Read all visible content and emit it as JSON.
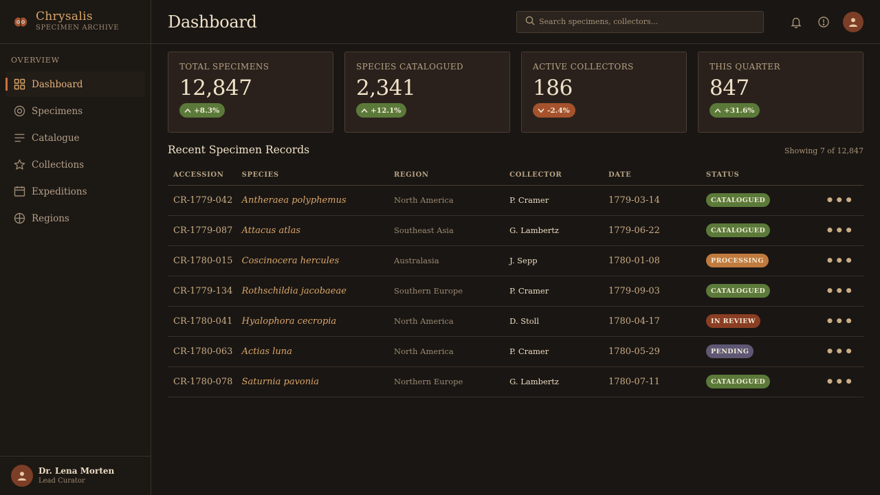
{
  "brand": {
    "title": "Chrysalis",
    "subtitle": "SPECIMEN ARCHIVE"
  },
  "sidebar": {
    "section_label": "OVERVIEW",
    "items": [
      {
        "label": "Dashboard",
        "icon": "grid-icon",
        "active": true
      },
      {
        "label": "Specimens",
        "icon": "target-icon",
        "active": false
      },
      {
        "label": "Catalogue",
        "icon": "list-icon",
        "active": false
      },
      {
        "label": "Collections",
        "icon": "star-icon",
        "active": false
      },
      {
        "label": "Expeditions",
        "icon": "calendar-icon",
        "active": false
      },
      {
        "label": "Regions",
        "icon": "globe-icon",
        "active": false
      }
    ],
    "user": {
      "name": "Dr. Lena Morten",
      "role": "Lead Curator"
    }
  },
  "header": {
    "title": "Dashboard",
    "search_placeholder": "Search specimens, collectors..."
  },
  "stats": [
    {
      "label": "TOTAL SPECIMENS",
      "value": "12,847",
      "delta": "+8.3%",
      "trend": "up"
    },
    {
      "label": "SPECIES CATALOGUED",
      "value": "2,341",
      "delta": "+12.1%",
      "trend": "up"
    },
    {
      "label": "ACTIVE COLLECTORS",
      "value": "186",
      "delta": "-2.4%",
      "trend": "down"
    },
    {
      "label": "THIS QUARTER",
      "value": "847",
      "delta": "+31.6%",
      "trend": "up"
    }
  ],
  "records": {
    "title": "Recent Specimen Records",
    "count_text": "Showing 7 of 12,847",
    "columns": [
      "ACCESSION",
      "SPECIES",
      "REGION",
      "COLLECTOR",
      "DATE",
      "STATUS"
    ],
    "rows": [
      {
        "accession": "CR-1779-042",
        "species": "Antheraea polyphemus",
        "region": "North America",
        "collector": "P. Cramer",
        "date": "1779-03-14",
        "status": "CATALOGUED"
      },
      {
        "accession": "CR-1779-087",
        "species": "Attacus atlas",
        "region": "Southeast Asia",
        "collector": "G. Lambertz",
        "date": "1779-06-22",
        "status": "CATALOGUED"
      },
      {
        "accession": "CR-1780-015",
        "species": "Coscinocera hercules",
        "region": "Australasia",
        "collector": "J. Sepp",
        "date": "1780-01-08",
        "status": "PROCESSING"
      },
      {
        "accession": "CR-1779-134",
        "species": "Rothschildia jacobaeae",
        "region": "Southern Europe",
        "collector": "P. Cramer",
        "date": "1779-09-03",
        "status": "CATALOGUED"
      },
      {
        "accession": "CR-1780-041",
        "species": "Hyalophora cecropia",
        "region": "North America",
        "collector": "D. Stoll",
        "date": "1780-04-17",
        "status": "IN REVIEW"
      },
      {
        "accession": "CR-1780-063",
        "species": "Actias luna",
        "region": "North America",
        "collector": "P. Cramer",
        "date": "1780-05-29",
        "status": "PENDING"
      },
      {
        "accession": "CR-1780-078",
        "species": "Saturnia pavonia",
        "region": "Northern Europe",
        "collector": "G. Lambertz",
        "date": "1780-07-11",
        "status": "CATALOGUED"
      }
    ]
  },
  "status_colors": {
    "CATALOGUED": "#5b7a3a",
    "PROCESSING": "#c07a3e",
    "IN REVIEW": "#8a3e24",
    "PENDING": "#5e5874"
  },
  "colors": {
    "accent": "#d9a66a",
    "background": "#1a1613",
    "card": "#2a211c"
  }
}
